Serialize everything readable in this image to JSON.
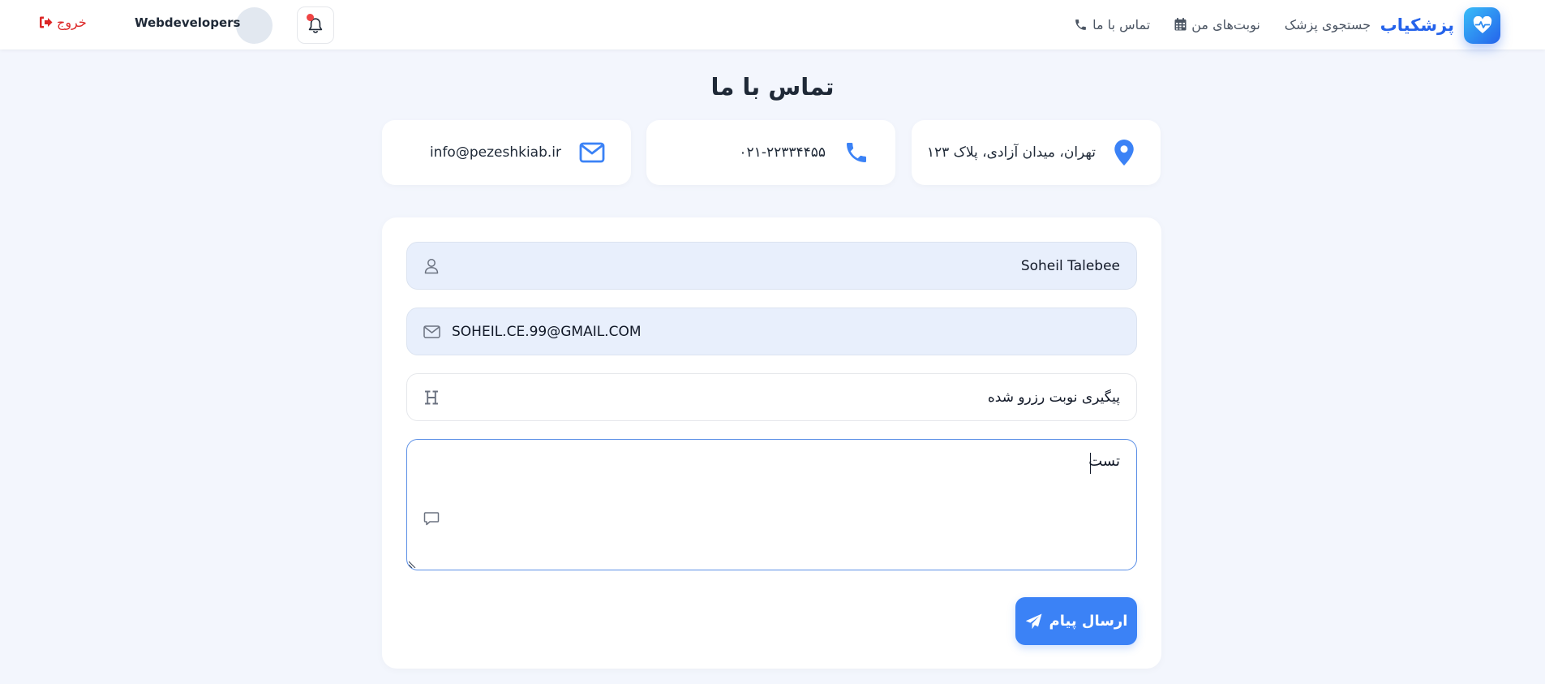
{
  "navbar": {
    "brand_name": "پزشکیاب",
    "links": [
      {
        "label": "جستجوی پزشک"
      },
      {
        "label": "نوبت‌های من"
      },
      {
        "label": "تماس با ما"
      }
    ],
    "username": "Webdevelopers",
    "logout_label": "خروج"
  },
  "page": {
    "title": "تماس با ما"
  },
  "contact_info": {
    "address": "تهران، میدان آزادی، پلاک ۱۲۳",
    "phone": "۰۲۱-۲۲۳۳۴۴۵۵",
    "email": "info@pezeshkiab.ir"
  },
  "form": {
    "name_value": "Soheil Talebee",
    "email_value": "SOHEIL.CE.99@GMAIL.COM",
    "subject_value": "پیگیری نوبت رزرو شده",
    "message_value": "تست",
    "submit_label": "ارسال پیام"
  },
  "colors": {
    "accent": "#3b82f6",
    "brand": "#2563eb",
    "danger": "#dc2626",
    "background": "#f3f6fd"
  },
  "icons": {
    "brand": "heart-pulse-icon",
    "calendar": "calendar-icon",
    "phone": "phone-icon",
    "bell": "bell-icon",
    "logout": "sign-out-icon",
    "location": "map-pin-icon",
    "email": "envelope-icon",
    "user": "user-icon",
    "heading": "heading-icon",
    "message": "message-icon",
    "send": "paper-plane-icon"
  }
}
